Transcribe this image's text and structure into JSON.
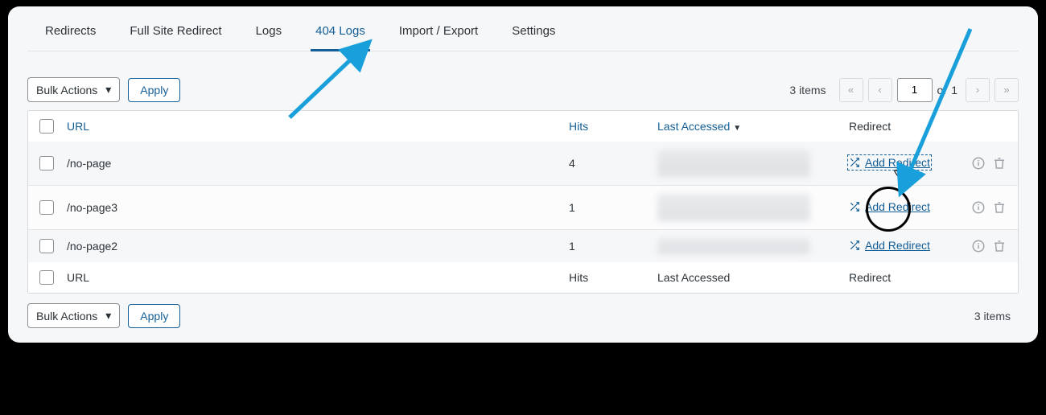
{
  "tabs": [
    {
      "label": "Redirects"
    },
    {
      "label": "Full Site Redirect"
    },
    {
      "label": "Logs"
    },
    {
      "label": "404 Logs"
    },
    {
      "label": "Import / Export"
    },
    {
      "label": "Settings"
    }
  ],
  "active_tab": "404 Logs",
  "toolbar": {
    "bulk_actions_label": "Bulk Actions",
    "apply_label": "Apply",
    "items_count": "3 items",
    "page_input": "1",
    "page_of_prefix": "of",
    "page_total": "1"
  },
  "columns": {
    "url": "URL",
    "hits": "Hits",
    "last_accessed": "Last Accessed",
    "redirect": "Redirect"
  },
  "footer_columns": {
    "url": "URL",
    "hits": "Hits",
    "last_accessed": "Last Accessed",
    "redirect": "Redirect"
  },
  "rows": [
    {
      "url": "/no-page",
      "hits": "4",
      "add_label": "Add Redirect"
    },
    {
      "url": "/no-page3",
      "hits": "1",
      "add_label": "Add Redirect"
    },
    {
      "url": "/no-page2",
      "hits": "1",
      "add_label": "Add Redirect"
    }
  ],
  "footer_items_count": "3 items",
  "icons": {
    "chevron_down": "▾",
    "dbl_left": "«",
    "single_left": "‹",
    "single_right": "›",
    "dbl_right": "»",
    "sort_desc": "▼"
  }
}
